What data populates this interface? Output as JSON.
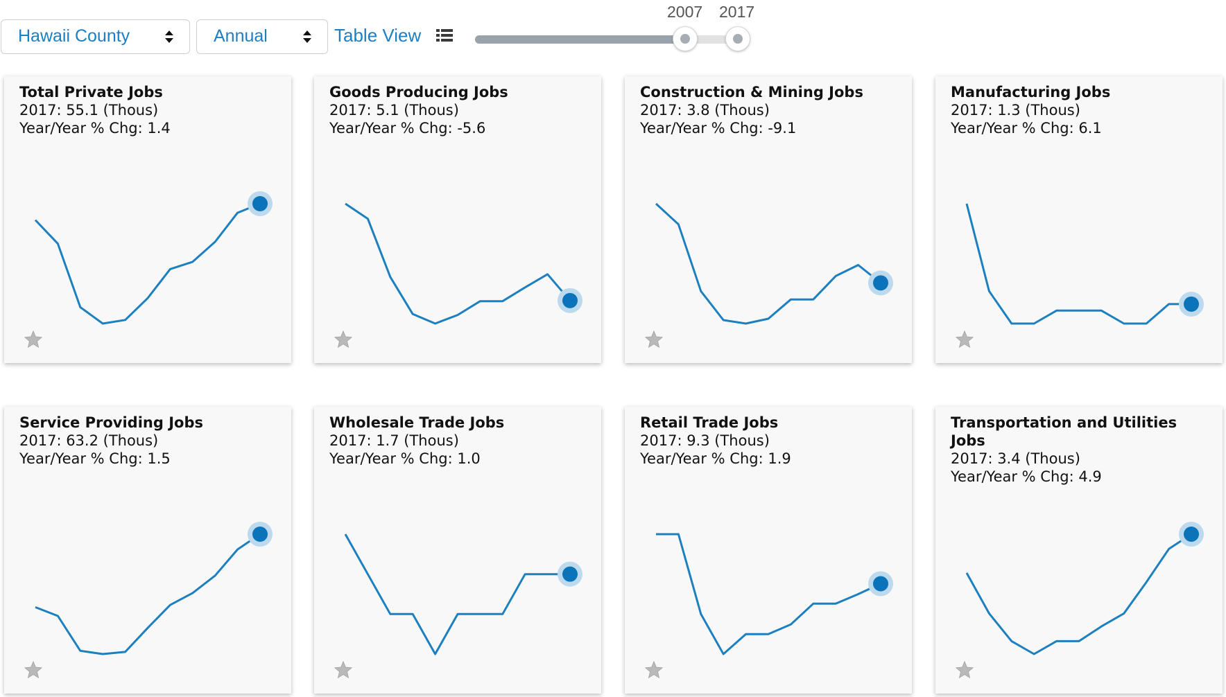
{
  "controls": {
    "region": "Hawaii County",
    "frequency": "Annual",
    "table_view_label": "Table View",
    "slider": {
      "start_label": "2007",
      "end_label": "2017"
    }
  },
  "colors": {
    "accent": "#1b7fc2",
    "line": "#1c7fbf",
    "marker": "#0a73b9",
    "halo": "#bcd9ee"
  },
  "icons": {
    "select": "up-down-caret-icon",
    "table_view": "list-icon",
    "favorite": "star-icon"
  },
  "cards": [
    {
      "title": "Total Private Jobs",
      "value_line": "2017: 55.1 (Thous)",
      "change_line": "Year/Year % Chg: 1.4",
      "sparkline": [
        58.2,
        56.9,
        53.4,
        52.5,
        52.7,
        53.9,
        55.5,
        55.9,
        57.0,
        58.6,
        59.1
      ]
    },
    {
      "title": "Goods Producing Jobs",
      "value_line": "2017: 5.1 (Thous)",
      "change_line": "Year/Year % Chg: -5.6",
      "sparkline": [
        8.55,
        8.06,
        6.16,
        4.95,
        4.64,
        4.92,
        5.37,
        5.37,
        5.82,
        6.25,
        5.39
      ]
    },
    {
      "title": "Construction & Mining Jobs",
      "value_line": "2017: 3.8 (Thous)",
      "change_line": "Year/Year % Chg: -9.1",
      "sparkline": [
        6.91,
        6.61,
        5.64,
        5.22,
        5.17,
        5.24,
        5.52,
        5.52,
        5.86,
        6.02,
        5.76
      ]
    },
    {
      "title": "Manufacturing Jobs",
      "value_line": "2017: 1.3 (Thous)",
      "change_line": "Year/Year % Chg: 6.1",
      "sparkline": [
        1.74,
        1.47,
        1.37,
        1.37,
        1.41,
        1.41,
        1.41,
        1.37,
        1.37,
        1.43,
        1.43
      ]
    },
    {
      "title": "Service Providing Jobs",
      "value_line": "2017: 63.2 (Thous)",
      "change_line": "Year/Year % Chg: 1.5",
      "sparkline": [
        51.2,
        50.4,
        47.2,
        46.9,
        47.1,
        49.3,
        51.4,
        52.5,
        54.1,
        56.5,
        57.9
      ]
    },
    {
      "title": "Wholesale Trade Jobs",
      "value_line": "2017: 1.7 (Thous)",
      "change_line": "Year/Year % Chg: 1.0",
      "sparkline": [
        1.85,
        1.75,
        1.65,
        1.65,
        1.55,
        1.65,
        1.65,
        1.65,
        1.75,
        1.75,
        1.75
      ]
    },
    {
      "title": "Retail Trade Jobs",
      "value_line": "2017: 9.3 (Thous)",
      "change_line": "Year/Year % Chg: 1.9",
      "sparkline": [
        9.85,
        9.85,
        8.85,
        8.35,
        8.6,
        8.6,
        8.72,
        8.98,
        8.98,
        9.1,
        9.23
      ]
    },
    {
      "title": "Transportation and Utilities Jobs",
      "value_line": "2017: 3.4 (Thous)",
      "change_line": "Year/Year % Chg: 4.9",
      "sparkline": [
        3.41,
        3.19,
        3.04,
        2.97,
        3.04,
        3.04,
        3.12,
        3.19,
        3.36,
        3.54,
        3.62
      ]
    }
  ]
}
